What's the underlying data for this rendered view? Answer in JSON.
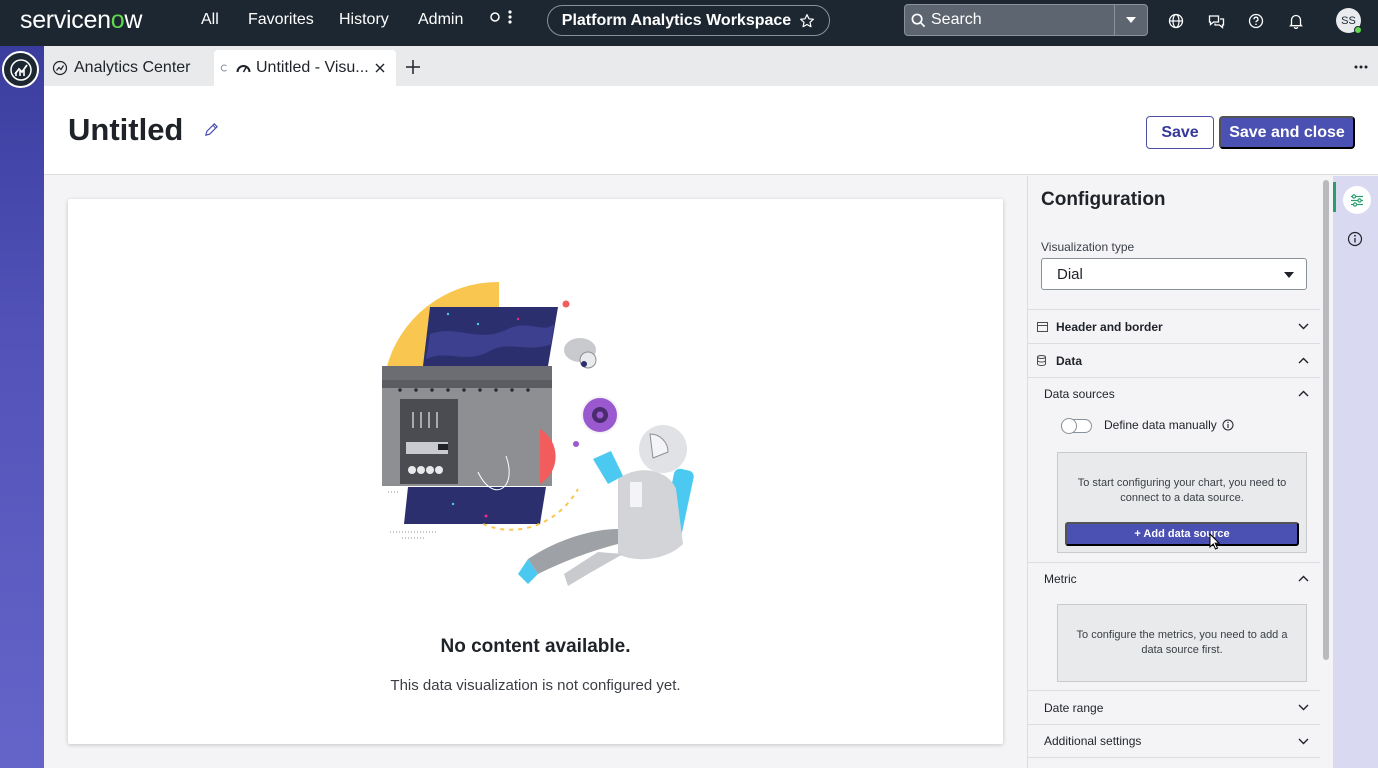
{
  "topnav": {
    "logo_text": "servicenow",
    "links": [
      "All",
      "Favorites",
      "History",
      "Admin"
    ],
    "workspace_name": "Platform Analytics Workspace",
    "search_placeholder": "Search",
    "user_initials": "SS"
  },
  "tabs": [
    {
      "label": "Analytics Center",
      "icon": "analytics-icon"
    },
    {
      "label": "Untitled - Visu...",
      "icon": "dial-chart-icon",
      "active": true
    }
  ],
  "header": {
    "title": "Untitled",
    "save_label": "Save",
    "save_close_label": "Save and close"
  },
  "canvas": {
    "empty_title": "No content available.",
    "empty_subtitle": "This data visualization is not configured yet."
  },
  "config": {
    "title": "Configuration",
    "viz_type_label": "Visualization type",
    "viz_type_value": "Dial",
    "sections": {
      "header_border": "Header and border",
      "data": "Data",
      "data_sources": "Data sources",
      "metric": "Metric",
      "date_range": "Date range",
      "additional": "Additional settings"
    },
    "define_manual_label": "Define data manually",
    "ds_message": "To start configuring your chart, you need to connect to a data source.",
    "add_ds_label": "+ Add data source",
    "metric_message": "To configure the metrics, you need to add a data source first."
  },
  "colors": {
    "nav_bg": "#1c2731",
    "accent": "#4b50b3",
    "brand_green": "#62d84e"
  }
}
